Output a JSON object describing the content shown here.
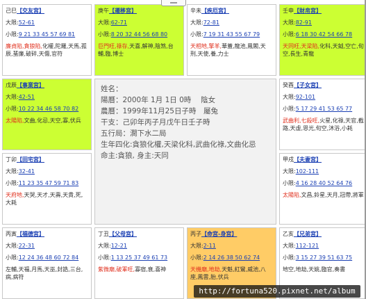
{
  "cells": {
    "siyi": {
      "header": "己巳",
      "title": "【交友宮】",
      "da_label": "大限:",
      "da": "52-61",
      "xiao_label": "小限:",
      "xiao": "9 21 33 45 57 69 81",
      "stars_red": "廉貞陷,貪狼陷,",
      "stars_rest": "化權,陀羅,天馬,孤辰,蜚廉,破碎,天傷,官符"
    },
    "gengwu": {
      "header": "庚午",
      "title": "【遷移宮】",
      "da_label": "大限:",
      "da": "62-71",
      "xiao_label": "小限:",
      "xiao": "8 20 32 44 56 68 80",
      "stars_red": "巨門旺,祿存,",
      "stars_rest": "天喜,解神,陰煞,台輔,臨,博士"
    },
    "xinwei": {
      "header": "辛未",
      "title": "【疾厄宮】",
      "da_label": "大限:",
      "da": "72-81",
      "xiao_label": "小限:",
      "xiao": "7 19 31 43 55 67 79",
      "stars_red": "天相地,擎羊,",
      "stars_rest": "華蓋,龍池,鳳閣,天刑,天使,養,力士"
    },
    "renshen": {
      "header": "壬申",
      "title": "【財帛宮】",
      "da_label": "大限:",
      "da": "82-91",
      "xiao_label": "小限:",
      "xiao": "6 18 30 42 54 66 78",
      "stars_red": "天同旺,天梁陷,",
      "stars_rest": "化科,天鉞,空亡,旬空,長生,青龍"
    },
    "wuchen": {
      "header": "戊辰",
      "title": "【事業宮】",
      "da_label": "大限:",
      "da": "42-51",
      "xiao_label": "小限:",
      "xiao": "10 22 34 46 58 70 82",
      "stars_red": "太陽陷,",
      "stars_rest": "文曲,化忌,天空,寡,伏兵"
    },
    "guiyou": {
      "header": "癸酉",
      "title": "【子女宮】",
      "da_label": "大限:",
      "da": "92-101",
      "xiao_label": "小限:",
      "xiao": "5 17 29 41 53 65 77",
      "stars_red": "武曲利,七殺旺,",
      "stars_rest": "火星,化祿,天官,截路,天虛,恩光,旬空,沐浴,小耗"
    },
    "dingmao": {
      "header": "丁卯",
      "title": "【田宅宮】",
      "da_label": "大限:",
      "da": "32-41",
      "xiao_label": "小限:",
      "xiao": "11 23 35 47 59 71 83",
      "stars_red": "天府地,",
      "stars_rest": "天哭,天才,天壽,天貴,死,大耗"
    },
    "jiaxu": {
      "header": "甲戌",
      "title": "【夫妻宮】",
      "da_label": "大限:",
      "da": "102-111",
      "xiao_label": "小限:",
      "xiao": "4 16 28 40 52 64 76",
      "stars_red": "太陽陷,",
      "stars_rest": "文昌,鈴星,天月,冠帶,將軍"
    },
    "bingyin": {
      "header": "丙寅",
      "title": "【福德宮】",
      "da_label": "大限:",
      "da": "22-31",
      "xiao_label": "小限:",
      "xiao": "12 24 36 48 60 72 84",
      "stars_red": "",
      "stars_rest": "左輔,天福,月馬,天巫,封誥,三台,病,病符"
    },
    "dingchou": {
      "header": "丁丑",
      "title": "【父母宮】",
      "da_label": "大限:",
      "da": "12-21",
      "xiao_label": "小限:",
      "xiao": "1 13 25 37 49 61 73",
      "stars_red": "紫微廟,破軍旺,",
      "stars_rest": "寡宿,衰,喜神"
    },
    "bingzi": {
      "header": "丙子",
      "title": "【命宮-身宮】",
      "da_label": "大限:",
      "da": "2-11",
      "xiao_label": "小限:",
      "xiao": "2 14 26 38 50 62 74",
      "stars_red": "天機廟,地劫,",
      "stars_rest": "天魁,紅鸞,威池,八座,鳳雲,胎,伏兵"
    },
    "yihai": {
      "header": "乙亥",
      "title": "【兄弟宮】",
      "da_label": "大限:",
      "da": "112-121",
      "xiao_label": "小限:",
      "xiao": "3 15 27 39 51 63 75",
      "stars_red": "",
      "stars_rest": "地空,地劫,天姚,臨官,奏書"
    }
  },
  "center": {
    "name": "姓名：",
    "solar": "陽曆：2000年 1月 1日 0時　 陰女",
    "lunar": "農曆：1999年11月25日子時　屬兔",
    "ganzhi": "干支：己卯年丙子月戊午日壬子時",
    "wuxing": "五行局：澗下水二局",
    "sihua": "生年四化:貪狼化權,天梁化科,武曲化祿,文曲化忌",
    "ming": "命主:貪狼, 身主:天同"
  },
  "watermark": "http://fortuna520.pixnet.net/album",
  "colors": {
    "green": "#ccff33",
    "orange": "#ffcc66",
    "link": "#1a3fb3",
    "red_star": "#e0301e"
  }
}
